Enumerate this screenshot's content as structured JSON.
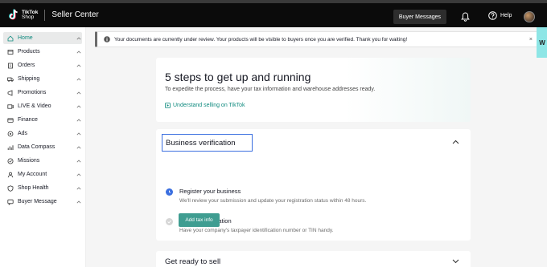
{
  "browser": {
    "tab_text": ""
  },
  "header": {
    "logo_line1": "TikTok",
    "logo_line2": "Shop",
    "title": "Seller Center",
    "buyer_messages_label": "Buyer Messages",
    "help_label": "Help",
    "icons": [
      "bell-icon",
      "help-icon",
      "avatar"
    ]
  },
  "sidebar": {
    "items": [
      {
        "label": "Home",
        "icon": "home-icon",
        "active": true
      },
      {
        "label": "Products",
        "icon": "box-icon"
      },
      {
        "label": "Orders",
        "icon": "orders-icon"
      },
      {
        "label": "Shipping",
        "icon": "truck-icon"
      },
      {
        "label": "Promotions",
        "icon": "promotions-icon"
      },
      {
        "label": "LIVE & Video",
        "icon": "video-icon"
      },
      {
        "label": "Finance",
        "icon": "finance-icon"
      },
      {
        "label": "Ads",
        "icon": "ads-icon"
      },
      {
        "label": "Data Compass",
        "icon": "chart-icon"
      },
      {
        "label": "Missions",
        "icon": "missions-icon"
      },
      {
        "label": "My Account",
        "icon": "user-icon"
      },
      {
        "label": "Shop Health",
        "icon": "shield-icon"
      },
      {
        "label": "Buyer Message",
        "icon": "message-icon"
      }
    ]
  },
  "notice": {
    "text": "Your documents are currently under review. Your products will be visible to buyers once you are verified. Thank you for waiting!",
    "close": "×",
    "side_tab": "W"
  },
  "steps_card": {
    "title": "5 steps to get up and running",
    "subtitle": "To expedite the process, have your tax information and warehouse addresses ready.",
    "link": "Understand selling on TikTok"
  },
  "verification_card": {
    "title": "Business verification",
    "steps": [
      {
        "title": "Register your business",
        "desc": "We'll review your submission and update your registration status within 48 hours.",
        "status": "in-progress"
      },
      {
        "title": "Add tax information",
        "desc": "Have your company's taxpayer identification number or TIN handy.",
        "status": "pending"
      }
    ],
    "button": "Add tax info"
  },
  "ready_card": {
    "title": "Get ready to sell"
  },
  "colors": {
    "accent": "#0e8a7e",
    "button": "#3f9d91",
    "focus_border": "#3b6fe0",
    "topbar": "#0b0b0b"
  }
}
